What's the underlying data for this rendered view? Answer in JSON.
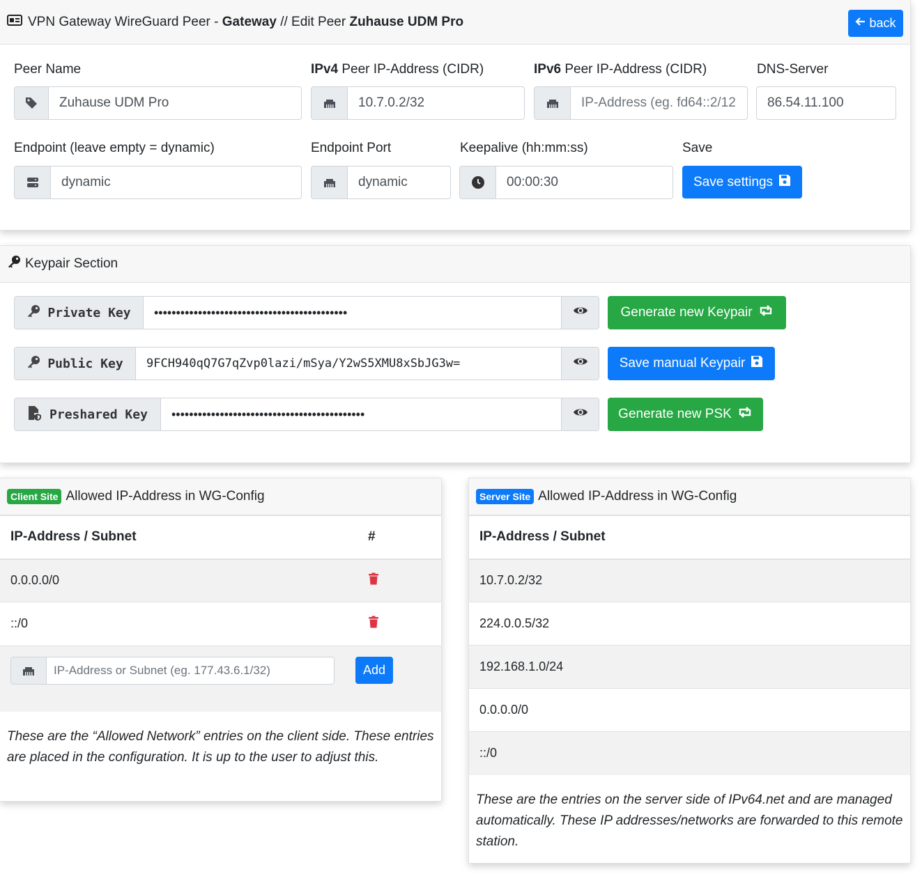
{
  "header": {
    "prefix": "VPN Gateway WireGuard Peer - ",
    "gateway": "Gateway",
    "middle": " // Edit Peer ",
    "peer_name": "Zuhause UDM Pro",
    "back_label": "back"
  },
  "form": {
    "peer_name_label": "Peer Name",
    "peer_name_value": "Zuhause UDM Pro",
    "ipv4_label_bold": "IPv4",
    "ipv4_label_rest": " Peer IP-Address (CIDR)",
    "ipv4_value": "10.7.0.2/32",
    "ipv6_label_bold": "IPv6",
    "ipv6_label_rest": " Peer IP-Address (CIDR)",
    "ipv6_placeholder": "IP-Address (eg. fd64::2/12",
    "dns_label": "DNS-Server",
    "dns_value": "86.54.11.100",
    "endpoint_label": "Endpoint (leave empty = dynamic)",
    "endpoint_value": "dynamic",
    "endpoint_port_label": "Endpoint Port",
    "endpoint_port_value": "dynamic",
    "keepalive_label": "Keepalive (hh:mm:ss)",
    "keepalive_value": "00:00:30",
    "save_label": "Save",
    "save_button": "Save settings"
  },
  "keypair": {
    "title": "Keypair Section",
    "private_key_label": "Private Key",
    "private_key_value": "••••••••••••••••••••••••••••••••••••••••••••",
    "public_key_label": "Public Key",
    "public_key_value": "9FCH940qQ7G7qZvp0lazi/mSya/Y2wS5XMU8xSbJG3w=",
    "preshared_key_label": "Preshared Key",
    "preshared_key_value": "••••••••••••••••••••••••••••••••••••••••••••",
    "generate_keypair_button": "Generate new Keypair",
    "save_manual_button": "Save manual Keypair",
    "generate_psk_button": "Generate new PSK"
  },
  "client_site": {
    "badge": "Client Site",
    "title": "Allowed IP-Address in WG-Config",
    "col_ip": "IP-Address / Subnet",
    "col_action": "#",
    "rows": [
      "0.0.0.0/0",
      "::/0"
    ],
    "add_placeholder": "IP-Address or Subnet (eg. 177.43.6.1/32)",
    "add_button": "Add",
    "note": "These are the “Allowed Network” entries on the client side. These entries are placed in the configuration. It is up to the user to adjust this."
  },
  "server_site": {
    "badge": "Server Site",
    "title": "Allowed IP-Address in WG-Config",
    "col_ip": "IP-Address / Subnet",
    "rows": [
      "10.7.0.2/32",
      "224.0.0.5/32",
      "192.168.1.0/24",
      "0.0.0.0/0",
      "::/0"
    ],
    "note": "These are the entries on the server side of IPv64.net and are managed automatically. These IP addresses/networks are forwarded to this remote station."
  },
  "colors": {
    "primary": "#0d7bf9",
    "success": "#28a745",
    "danger": "#dc3545"
  },
  "icons": [
    "id-card-icon",
    "arrow-left-icon",
    "tag-icon",
    "ethernet-icon",
    "server-icon",
    "clock-icon",
    "floppy-disk-icon",
    "key-icon",
    "eye-icon",
    "refresh-icon",
    "file-shield-icon",
    "trash-icon"
  ]
}
